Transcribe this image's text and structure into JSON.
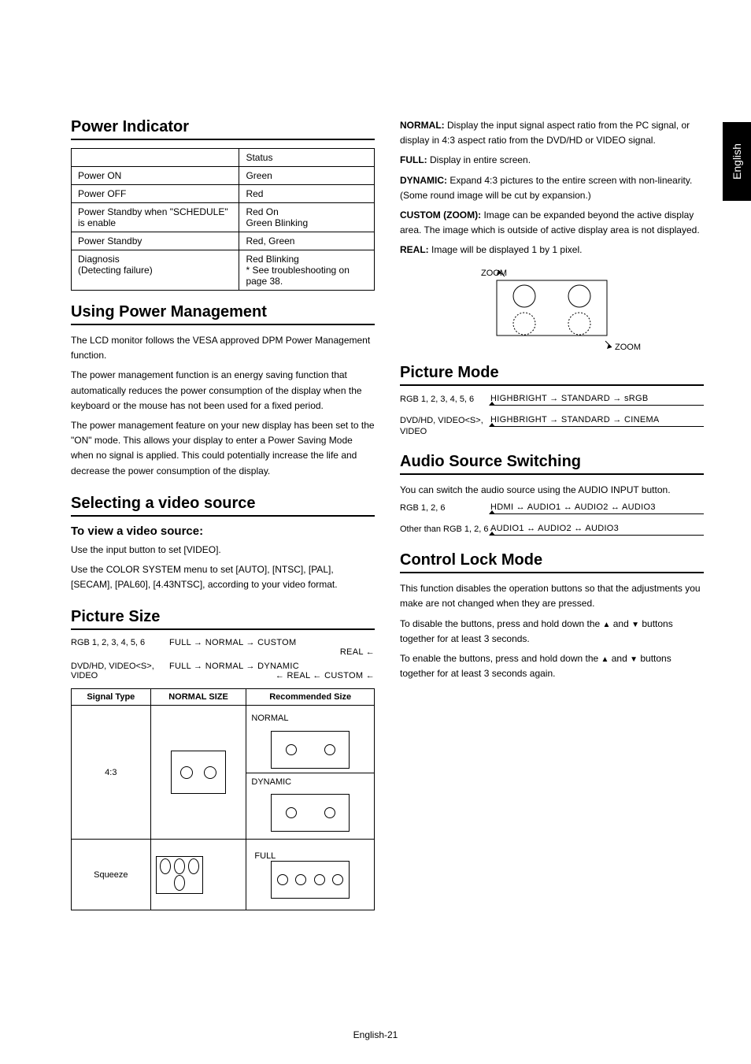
{
  "side_tab": "English",
  "footer": "English-21",
  "left": {
    "h_power_indicator": "Power Indicator",
    "table": {
      "head0": "",
      "head1": "Status",
      "rows": [
        [
          "Power ON",
          "Green"
        ],
        [
          "Power OFF",
          "Red"
        ],
        [
          "Power Standby when \"SCHEDULE\" is enable",
          "Red On\nGreen Blinking"
        ],
        [
          "Power Standby",
          "Red, Green"
        ],
        [
          "Diagnosis\n(Detecting failure)",
          "Red Blinking\n* See troubleshooting on page 38."
        ]
      ]
    },
    "h_using_pm": "Using Power Management",
    "pm_p1": "The LCD monitor follows the VESA approved DPM Power Management function.",
    "pm_p2": "The power management function is an energy saving function that automatically reduces the power consumption of the display when the keyboard or the mouse has not been used for a fixed period.",
    "pm_p3": "The power management feature on your new display has been set to the \"ON\" mode. This allows your display to enter a Power Saving Mode when no signal is applied. This could potentially increase the life and decrease the power consumption of the display.",
    "h_selecting": "Selecting a video source",
    "sel_sub": "To view a video source:",
    "sel_p1": "Use the input button to set [VIDEO].",
    "sel_p2": "Use the COLOR SYSTEM menu to set [AUTO], [NTSC], [PAL], [SECAM], [PAL60], [4.43NTSC], according to your video format.",
    "h_picsize": "Picture Size",
    "psize_row1_lbl": "RGB 1, 2, 3, 4, 5, 6",
    "psize_row1_seq_top": "FULL → NORMAL → CUSTOM",
    "psize_row1_seq_bot": "REAL  ←",
    "psize_row2_lbl": "DVD/HD, VIDEO<S>, VIDEO",
    "psize_row2_seq_top": "FULL → NORMAL → DYNAMIC",
    "psize_row2_seq_bot": "← REAL ← CUSTOM ←",
    "sig_h0": "Signal Type",
    "sig_h1": "NORMAL SIZE",
    "sig_h2": "Recommended Size",
    "sig_r1_c0": "4:3",
    "sig_r1_c2a": "NORMAL",
    "sig_r1_c2b": "DYNAMIC",
    "sig_r2_c0": "Squeeze",
    "sig_r2_c2a": "FULL"
  },
  "right": {
    "modes": {
      "normal_b": "NORMAL:",
      "normal_t": " Display the input signal aspect ratio from the PC signal, or display in 4:3 aspect ratio from the DVD/HD or VIDEO signal.",
      "full_b": "FULL:",
      "full_t": " Display in entire screen.",
      "dyn_b": "DYNAMIC:",
      "dyn_t": "  Expand 4:3 pictures to the entire screen with non-linearity. (Some round image will be cut by expansion.)",
      "custom_b": "CUSTOM (ZOOM):",
      "custom_t": " Image can be expanded beyond the active display area. The image which is outside of active display area is not displayed.",
      "real_b": "REAL:",
      "real_t": " Image will be displayed 1 by 1 pixel.",
      "zoom_l": "ZOOM",
      "zoom_r": "ZOOM"
    },
    "h_picture_mode": "Picture Mode",
    "pm_row1_lbl": "RGB 1, 2, 3, 4, 5, 6",
    "pm_row1_seq": "HIGHBRIGHT → STANDARD → sRGB",
    "pm_row2_lbl": "DVD/HD, VIDEO<S>, VIDEO",
    "pm_row2_seq": "HIGHBRIGHT → STANDARD → CINEMA",
    "h_audio": "Audio Source Switching",
    "audio_p": "You can switch the audio source using the AUDIO INPUT button.",
    "audio_row1_lbl": "RGB 1, 2, 6",
    "audio_row1_seq": "HDMI ↔ AUDIO1 ↔ AUDIO2 ↔ AUDIO3",
    "audio_row2_lbl": "Other than RGB 1, 2, 6",
    "audio_row2_seq": "AUDIO1 ↔ AUDIO2 ↔ AUDIO3",
    "h_control_lock": "Control Lock Mode",
    "cl_p1": "This function disables the operation buttons so that the adjustments you make are not changed when they are pressed.",
    "cl_p2a": "To disable the buttons, press and hold down the ",
    "cl_p2b": " and ",
    "cl_p2c": " buttons together for at least 3 seconds.",
    "cl_p3a": "To enable the buttons, press and hold down the ",
    "cl_p3b": " and ",
    "cl_p3c": " buttons together for at least 3 seconds again."
  }
}
